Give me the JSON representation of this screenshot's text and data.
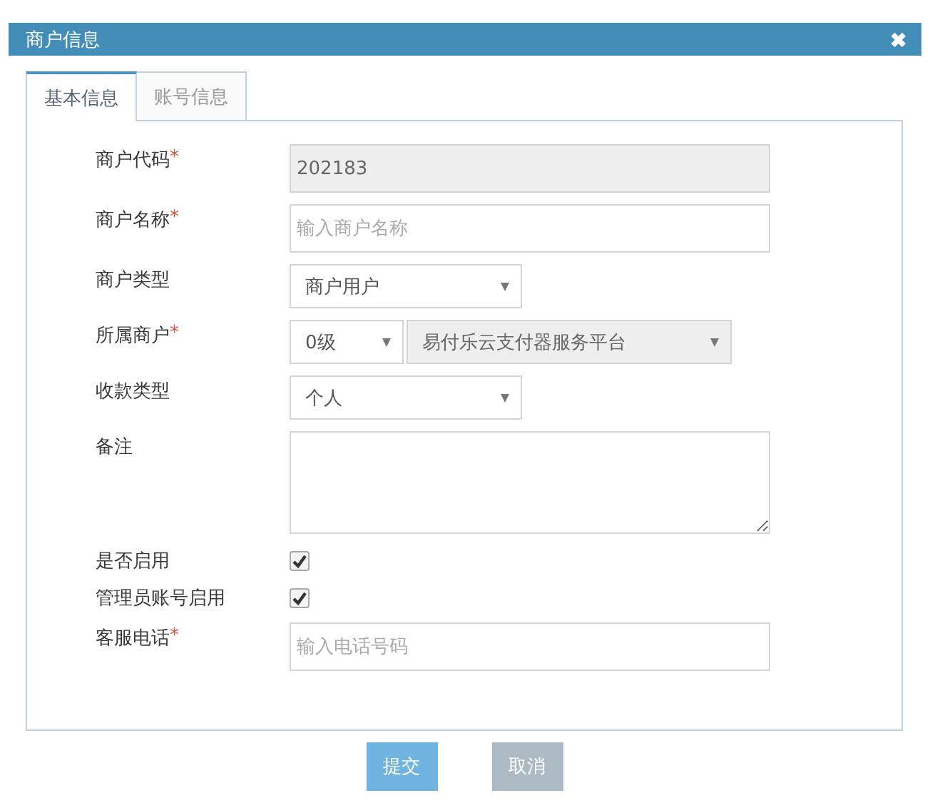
{
  "dialog": {
    "title": "商户信息",
    "close": "✖"
  },
  "tabs": [
    {
      "label": "基本信息",
      "selected": true
    },
    {
      "label": "账号信息",
      "selected": false
    }
  ],
  "fields": [
    {
      "kind": "text",
      "label": "商户代码",
      "mark": "*",
      "value": "202183",
      "disabled": true
    },
    {
      "kind": "text",
      "label": "商户名称",
      "mark": "*",
      "placeholder": "输入商户名称",
      "disabled": false
    },
    {
      "kind": "select",
      "label": "商户类型",
      "value": "商户用户"
    },
    {
      "kind": "double-select",
      "label": "所属商户",
      "mark": "*",
      "value": "0级",
      "value2": "易付乐云支付器服务平台"
    },
    {
      "kind": "select",
      "label": "收款类型",
      "value": "个人"
    },
    {
      "kind": "textarea",
      "label": "备注"
    },
    {
      "kind": "checkbox",
      "label": "是否启用",
      "checked": true
    },
    {
      "kind": "checkbox",
      "label": "管理员账号启用",
      "checked": true
    },
    {
      "kind": "text",
      "label": "客服电话",
      "mark": "*",
      "placeholder": "输入电话号码",
      "disabled": false
    }
  ],
  "buttons": [
    {
      "label": "提交",
      "kind": "primary"
    },
    {
      "label": "取消",
      "kind": "secondary"
    }
  ]
}
